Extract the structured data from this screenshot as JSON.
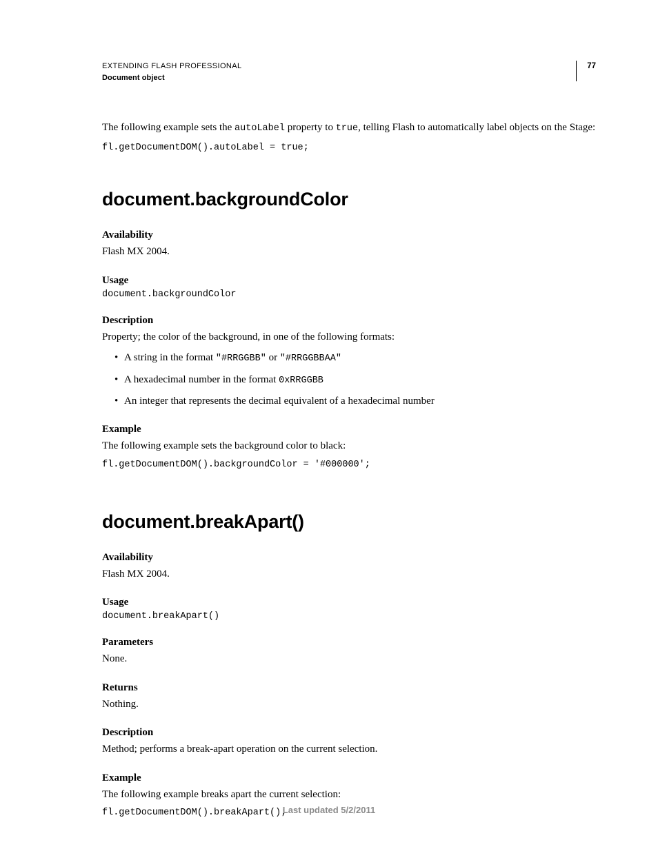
{
  "header": {
    "title": "EXTENDING FLASH PROFESSIONAL",
    "subtitle": "Document object",
    "page_number": "77"
  },
  "intro": {
    "prefix": "The following example sets the ",
    "code1": "autoLabel",
    "mid": " property to ",
    "code2": "true",
    "suffix": ", telling Flash to automatically label objects on the Stage:",
    "code_block": "fl.getDocumentDOM().autoLabel = true;"
  },
  "section1": {
    "title": "document.backgroundColor",
    "availability_label": "Availability",
    "availability_body": "Flash MX 2004.",
    "usage_label": "Usage",
    "usage_code": "document.backgroundColor",
    "description_label": "Description",
    "description_body": "Property; the color of the background, in one of the following formats:",
    "bullets": [
      {
        "pre": "A string in the format ",
        "c1": "\"#RRGGBB\"",
        "mid": " or ",
        "c2": "\"#RRGGBBAA\""
      },
      {
        "pre": "A hexadecimal number in the format ",
        "c1": "0xRRGGBB",
        "mid": "",
        "c2": ""
      },
      {
        "pre": "An integer that represents the decimal equivalent of a hexadecimal number",
        "c1": "",
        "mid": "",
        "c2": ""
      }
    ],
    "example_label": "Example",
    "example_body": "The following example sets the background color to black:",
    "example_code": "fl.getDocumentDOM().backgroundColor = '#000000';"
  },
  "section2": {
    "title": "document.breakApart()",
    "availability_label": "Availability",
    "availability_body": "Flash MX 2004.",
    "usage_label": "Usage",
    "usage_code": "document.breakApart()",
    "parameters_label": "Parameters",
    "parameters_body": "None.",
    "returns_label": "Returns",
    "returns_body": "Nothing.",
    "description_label": "Description",
    "description_body": "Method; performs a break-apart operation on the current selection.",
    "example_label": "Example",
    "example_body": "The following example breaks apart the current selection:",
    "example_code": "fl.getDocumentDOM().breakApart();"
  },
  "footer": {
    "text": "Last updated 5/2/2011"
  }
}
